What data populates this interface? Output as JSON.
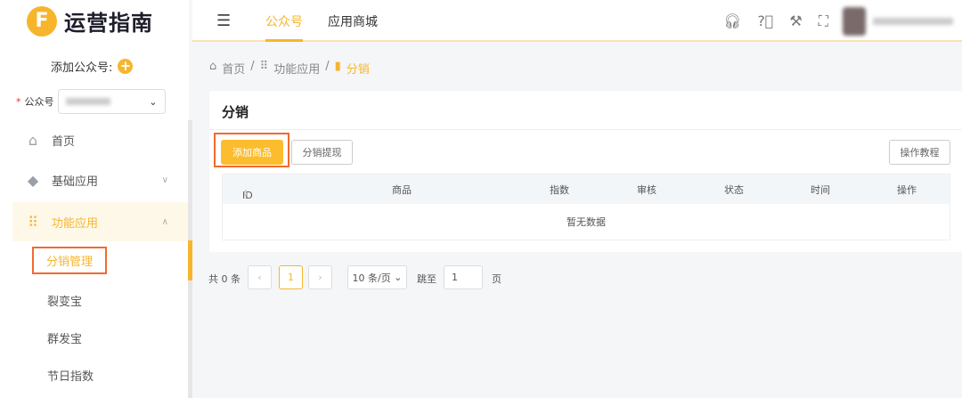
{
  "logo": {
    "mark": "F",
    "text": "运营指南"
  },
  "sidebar": {
    "add_account_label": "添加公众号:",
    "account_label": "公众号",
    "nav": [
      {
        "label": "首页",
        "icon": "home-icon"
      },
      {
        "label": "基础应用",
        "icon": "cube-icon"
      },
      {
        "label": "功能应用",
        "icon": "grid-icon"
      }
    ],
    "sub": [
      "分销管理",
      "裂变宝",
      "群发宝",
      "节日指数"
    ]
  },
  "header": {
    "tabs": [
      "公众号",
      "应用商城"
    ]
  },
  "breadcrumb": [
    "首页",
    "功能应用",
    "分销"
  ],
  "card": {
    "title": "分销",
    "add_button": "添加商品",
    "withdraw_button": "分销提现",
    "tutorial_button": "操作教程",
    "columns": [
      "ID",
      "商品",
      "指数",
      "审核",
      "状态",
      "时间",
      "操作"
    ],
    "empty": "暂无数据"
  },
  "pagination": {
    "total": "共 0 条",
    "current": "1",
    "page_size": "10 条/页",
    "jump_label": "跳至",
    "jump_value": "1",
    "page_suffix": "页"
  },
  "colors": {
    "accent": "#f7b52c",
    "highlight": "#f26a2d"
  }
}
